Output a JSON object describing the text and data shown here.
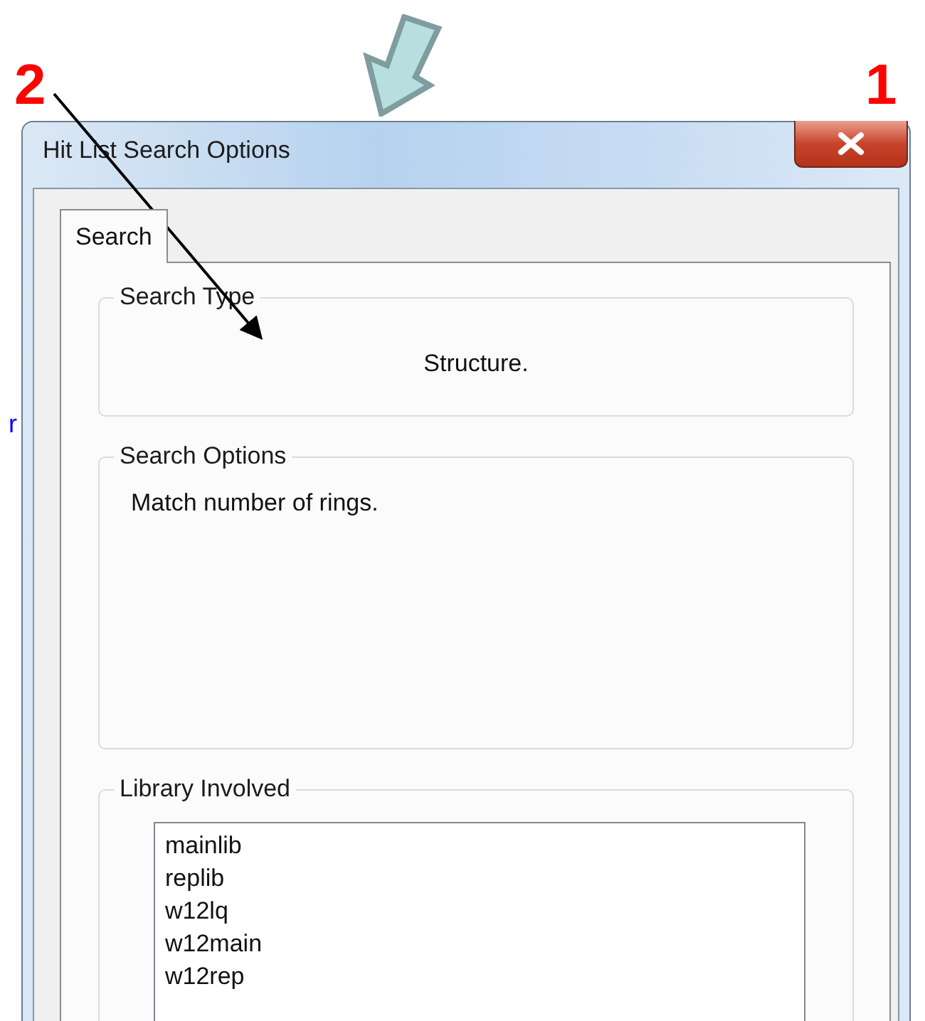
{
  "annotations": [
    {
      "label": "2"
    },
    {
      "label": "1"
    }
  ],
  "background_text": "r",
  "window": {
    "title": "Hit List Search Options"
  },
  "tabs": [
    {
      "label": "Search",
      "selected": true
    }
  ],
  "search_type": {
    "title": "Search Type",
    "value": "Structure."
  },
  "search_options": {
    "title": "Search Options",
    "text": "Match number of rings."
  },
  "library_involved": {
    "title": "Library Involved",
    "items": [
      "mainlib",
      "replib",
      "w12lq",
      "w12main",
      "w12rep"
    ]
  }
}
